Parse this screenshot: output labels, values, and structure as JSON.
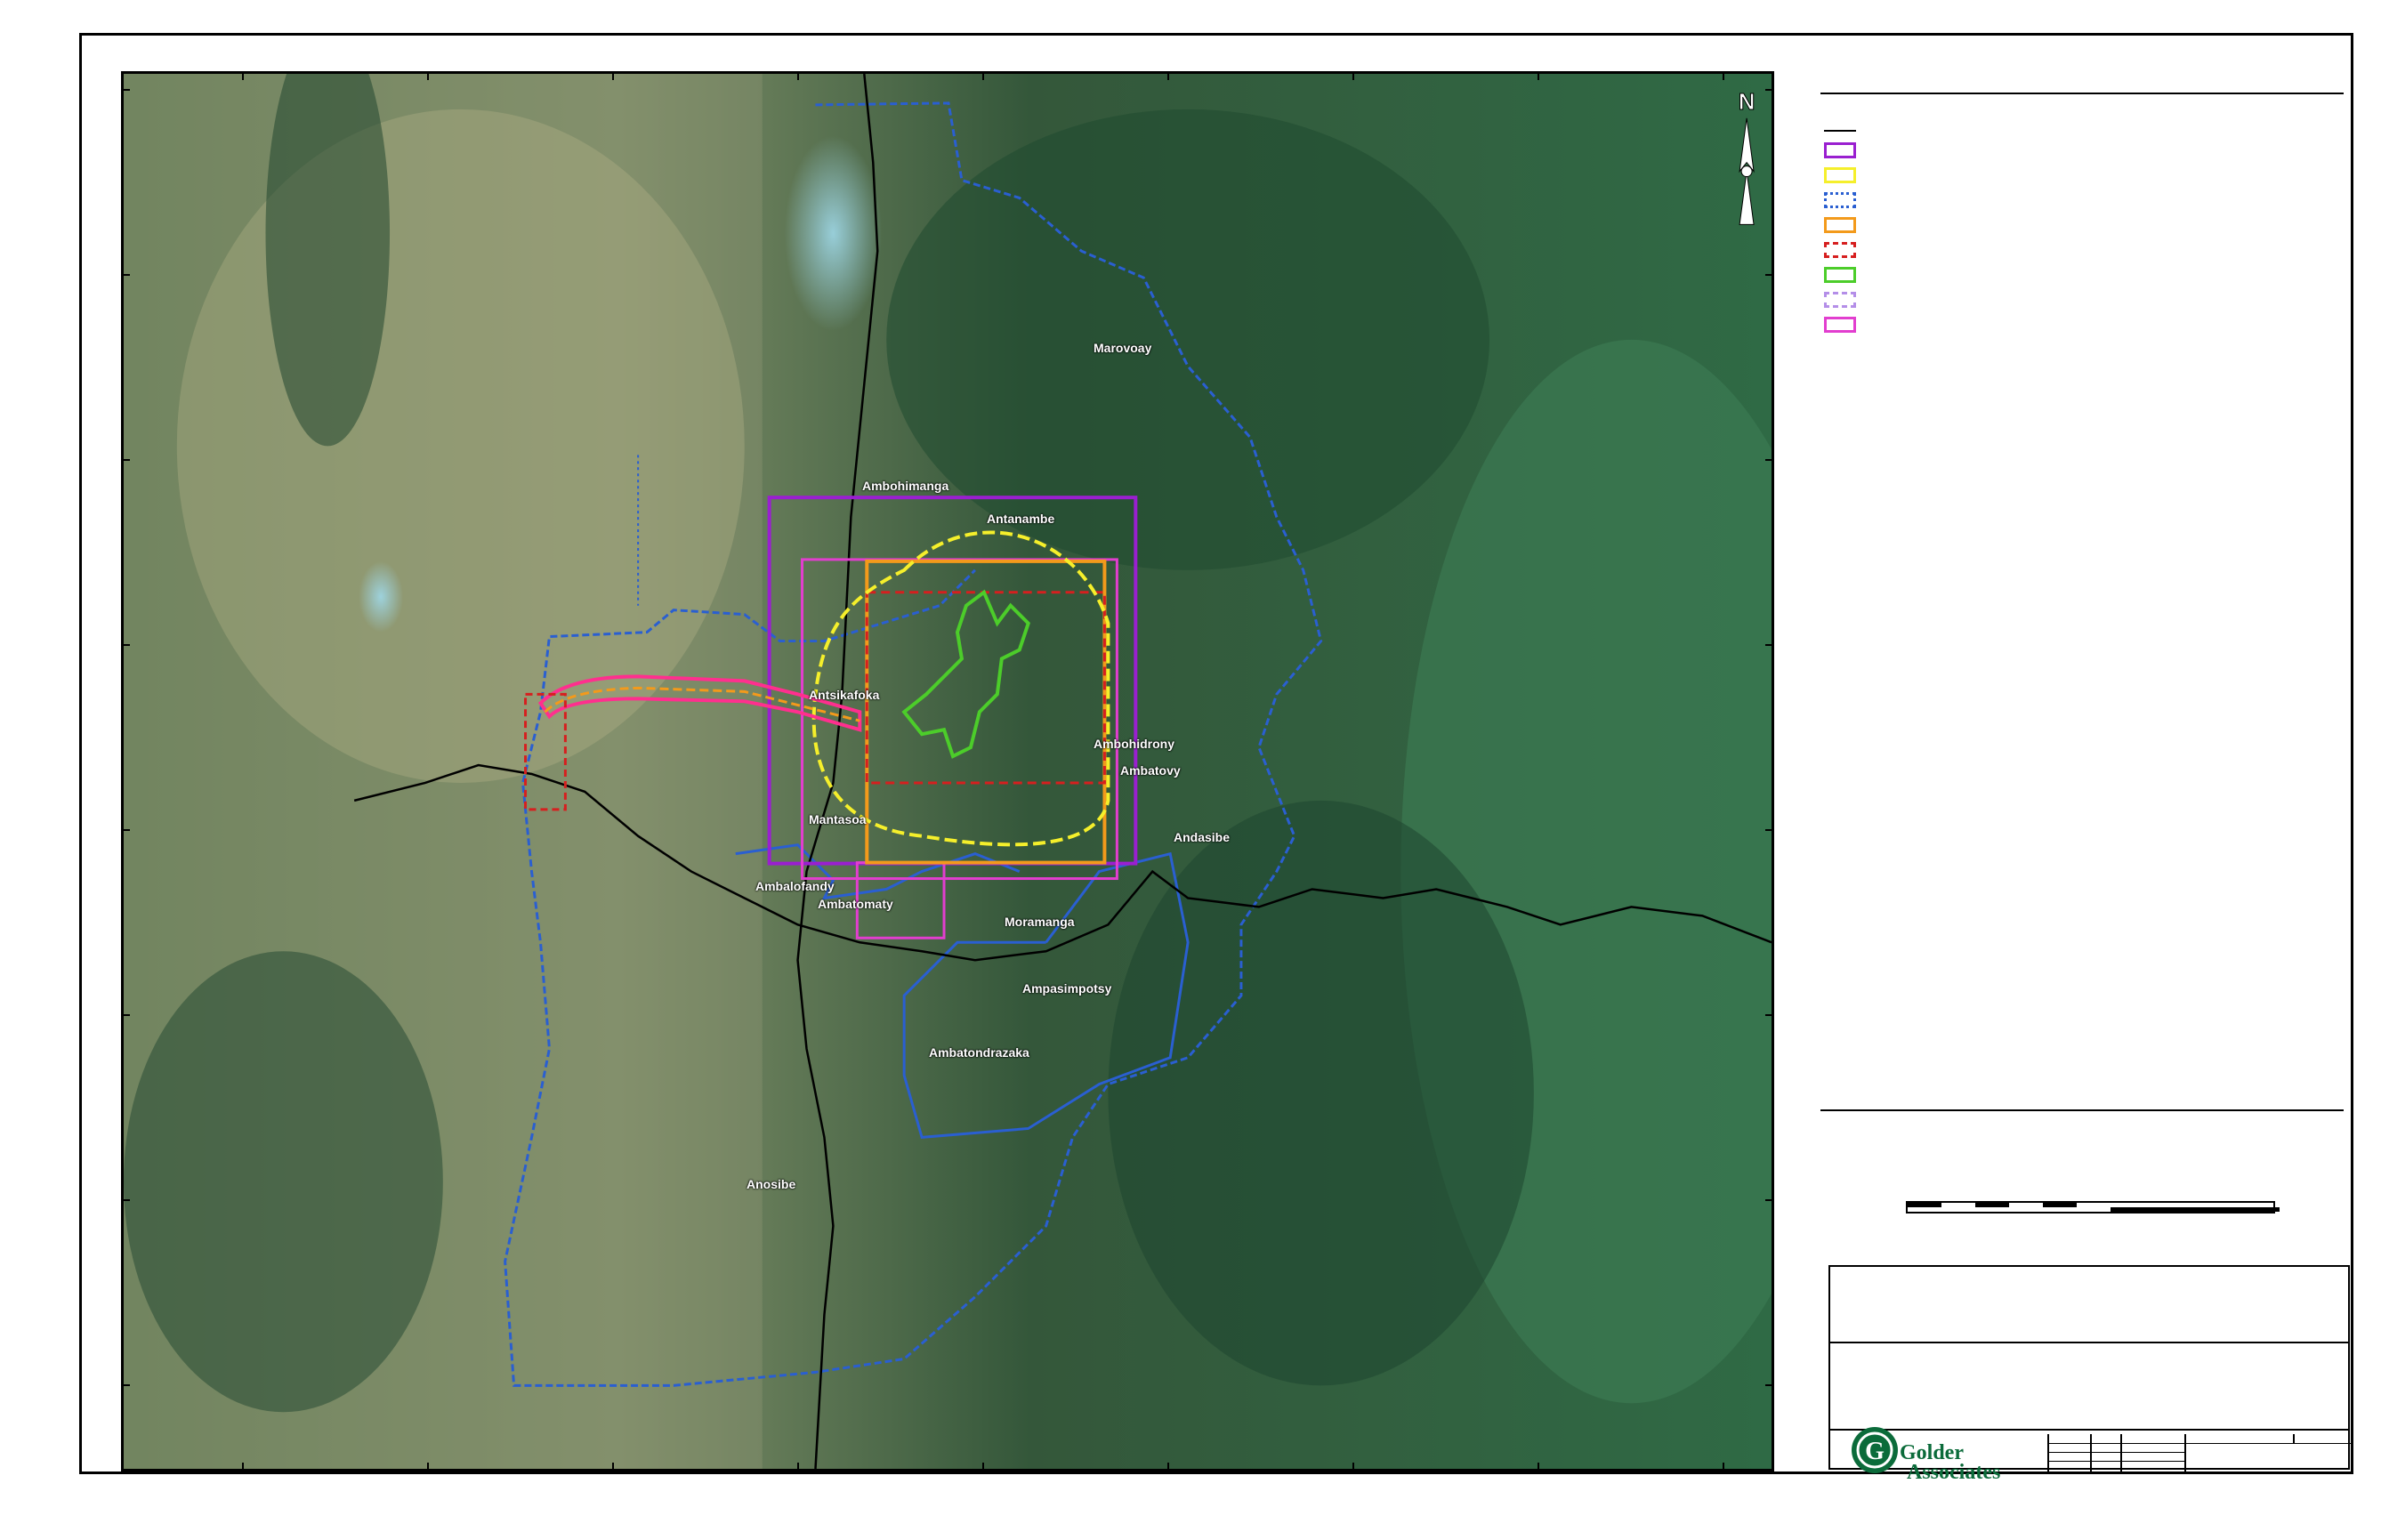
{
  "map": {
    "place_labels": [
      {
        "id": "label-1",
        "text": "Marovoay"
      },
      {
        "id": "label-2",
        "text": "Ambohimanga"
      },
      {
        "id": "label-3",
        "text": "Antanambe"
      },
      {
        "id": "label-4",
        "text": "Antsikafoka"
      },
      {
        "id": "label-5",
        "text": "Ambohidrony"
      },
      {
        "id": "label-6",
        "text": "Ambatovy"
      },
      {
        "id": "label-7",
        "text": "Mantasoa"
      },
      {
        "id": "label-8",
        "text": "Andasibe"
      },
      {
        "id": "label-9",
        "text": "Ambalofandy"
      },
      {
        "id": "label-10",
        "text": "Ambatomaty"
      },
      {
        "id": "label-11",
        "text": "Moramanga"
      },
      {
        "id": "label-12",
        "text": "Ampasimpotsy"
      },
      {
        "id": "label-13",
        "text": "Anosibe"
      },
      {
        "id": "label-14",
        "text": "Ambatondrazaka"
      }
    ],
    "north_arrow_label": "N"
  },
  "legend": {
    "items": [
      {
        "color": "#000000",
        "style": "line"
      },
      {
        "color": "#9a1fd0",
        "style": "solid-box"
      },
      {
        "color": "#f5ef2b",
        "style": "solid-box"
      },
      {
        "color": "#2a5fd1",
        "style": "dotted-box"
      },
      {
        "color": "#f39a1b",
        "style": "solid-box"
      },
      {
        "color": "#d61f1f",
        "style": "dashed-box"
      },
      {
        "color": "#4ccd2a",
        "style": "solid-box"
      },
      {
        "color": "#b48ee8",
        "style": "dashed-box"
      },
      {
        "color": "#e23ecf",
        "style": "solid-box"
      }
    ]
  },
  "title_block": {
    "company_line1": "Golder",
    "company_line2": "Associates"
  },
  "colors": {
    "purple_box": "#9a1fd0",
    "magenta": "#e8379c",
    "yellow": "#f5ef2b",
    "orange": "#f39a1b",
    "red_dashed": "#d61f1f",
    "green_outline": "#4ccd2a",
    "blue_boundary": "#2a5fd1",
    "road": "#000000",
    "logo_green": "#0b6b3a"
  },
  "icons": [
    "north-arrow-icon",
    "golder-logo-icon"
  ]
}
